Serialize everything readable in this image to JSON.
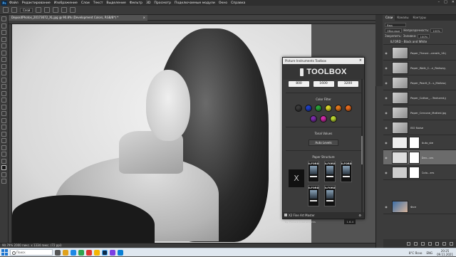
{
  "menubar": {
    "app_icon": "Ps",
    "items": [
      "Файл",
      "Редактирование",
      "Изображение",
      "Слои",
      "Текст",
      "Выделение",
      "Фильтр",
      "3D",
      "Просмотр",
      "Подключаемые модули",
      "Окно",
      "Справка"
    ]
  },
  "options": {
    "mode": "Слой",
    "label": "Авто выбор"
  },
  "document": {
    "tab_title": "DepositPhotos_20173672_XL.jpg @ 90.8% (Development Colors, RGB/8*) *",
    "close": "×"
  },
  "statusbar": {
    "zoom": "90.79%",
    "info": "2000 пикс. x 1334 пикс. (72 ppi)"
  },
  "toolbox": {
    "window_title": "Picture Instruments Toolbox",
    "close": "×",
    "title": "TOOLBOX",
    "iso_values": [
      "800",
      "1600",
      "3200"
    ],
    "color_filter_label": "Color Filter",
    "color_filters": [
      {
        "name": "none",
        "color": "#3a3a3a"
      },
      {
        "name": "blue",
        "color": "#1f3fbf"
      },
      {
        "name": "green",
        "color": "#2aa03a"
      },
      {
        "name": "yellow",
        "color": "#d8d32b"
      },
      {
        "name": "orange",
        "color": "#e0761d"
      },
      {
        "name": "red-orange",
        "color": "#e56a1e"
      },
      {
        "name": "purple",
        "color": "#7a2ca8"
      },
      {
        "name": "magenta",
        "color": "#cc2aa6"
      },
      {
        "name": "yellow-green",
        "color": "#b7d330"
      }
    ],
    "tonal_values_label": "Tonal Values",
    "auto_levels_label": "Auto Levels",
    "paper_structure_label": "Paper Structure",
    "x_label": "X",
    "paper_brands": [
      "ILFORD",
      "ILFORD",
      "ILFORD",
      "ILFORD",
      "ILFORD",
      "ILFORD"
    ],
    "product_name": "X2 Fine Art Master",
    "footer": "by Picture Instruments",
    "version": "1.6.4"
  },
  "panel": {
    "tabs": [
      "Слои",
      "Каналы",
      "Контуры"
    ],
    "blend_mode": "Обычные",
    "opacity_label": "Непрозрачность:",
    "opacity": "100%",
    "lock_label": "Закрепить:",
    "fill_label": "Заливка:",
    "fill": "100%",
    "group_name": "ILFORD - Black and White",
    "layers": [
      {
        "name": "Paper_Theuvi...ceroth_16.jpg",
        "selected": false
      },
      {
        "name": "Paper_Walk_C...n_Redway.jpg",
        "selected": false
      },
      {
        "name": "Paper_Pearlt_E...s_Mallow.jpg",
        "selected": false
      },
      {
        "name": "Paper_Cotton_...Textured.jpg",
        "selected": false
      },
      {
        "name": "Paper_Cercone_Matted.jpg",
        "selected": false
      },
      {
        "name": "ISO Noise",
        "selected": false
      },
      {
        "name": "Auto_ste",
        "selected": false
      },
      {
        "name": "Dev...ors",
        "selected": true
      },
      {
        "name": "Colo...ers",
        "selected": false
      },
      {
        "name": "Фон",
        "selected": false
      }
    ]
  },
  "taskbar": {
    "search_placeholder": "Поиск",
    "weather": "8°C Ясно",
    "lang": "ENG",
    "time": "20:25",
    "date": "09.11.2021"
  }
}
